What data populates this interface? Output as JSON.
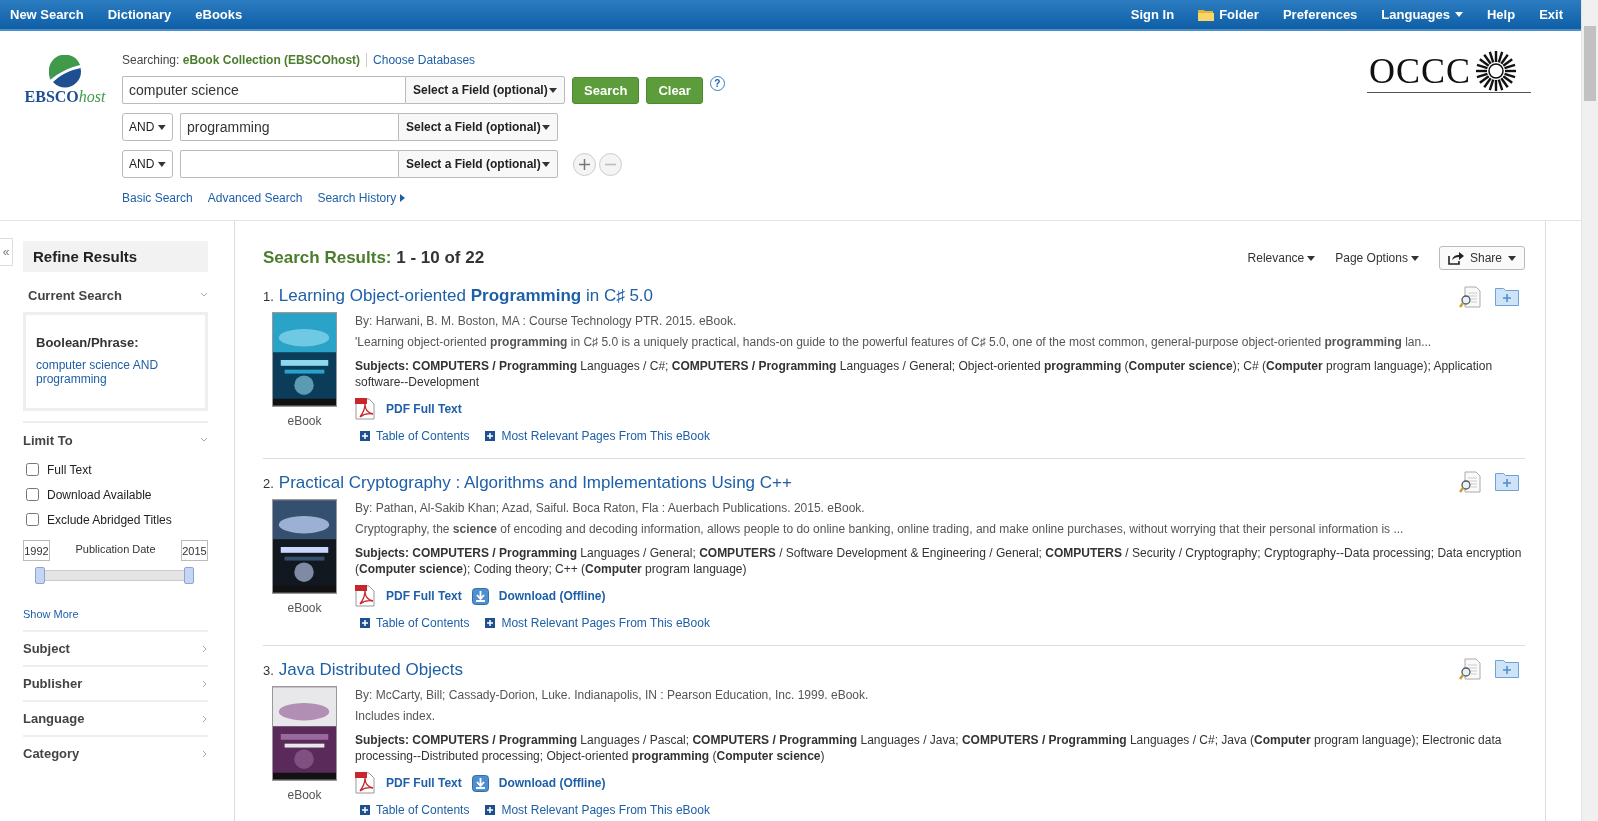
{
  "topbar": {
    "left_links": [
      "New Search",
      "Dictionary",
      "eBooks"
    ],
    "right_links": [
      {
        "label": "Sign In",
        "kind": "plain"
      },
      {
        "label": "Folder",
        "kind": "folder"
      },
      {
        "label": "Preferences",
        "kind": "plain"
      },
      {
        "label": "Languages",
        "kind": "dropdown"
      },
      {
        "label": "Help",
        "kind": "plain"
      },
      {
        "label": "Exit",
        "kind": "plain"
      }
    ]
  },
  "header": {
    "logo": {
      "main": "EBSCO",
      "suffix": "host"
    },
    "partner_logo": "OCCC"
  },
  "search": {
    "searching_label": "Searching:",
    "database": "eBook Collection (EBSCOhost)",
    "choose_link": "Choose Databases",
    "rows": [
      {
        "value": "computer science",
        "field": "Select a Field (optional)"
      },
      {
        "operator": "AND",
        "value": "programming",
        "field": "Select a Field (optional)"
      },
      {
        "operator": "AND",
        "field": "Select a Field (optional)"
      }
    ],
    "buttons": [
      "Search",
      "Clear"
    ],
    "help": "?",
    "links": [
      {
        "label": "Basic Search",
        "kind": "plain"
      },
      {
        "label": "Advanced Search",
        "kind": "plain"
      },
      {
        "label": "Search History",
        "kind": "arrow"
      }
    ]
  },
  "sidebar": {
    "collapse": "«",
    "title": "Refine Results",
    "current_search": {
      "heading": "Current Search",
      "label": "Boolean/Phrase:",
      "query": "computer science AND programming"
    },
    "limit_to": {
      "heading": "Limit To",
      "options": [
        {
          "label": "Full Text",
          "checked": false
        },
        {
          "label": "Download Available",
          "checked": false
        },
        {
          "label": "Exclude Abridged Titles",
          "checked": false
        }
      ],
      "date": {
        "from": "1992",
        "label": "Publication Date",
        "to": "2015",
        "thumbs": [
          {
            "level": 0
          },
          {
            "level": 1
          }
        ]
      },
      "show_more": "Show More"
    },
    "facets": [
      "Subject",
      "Publisher",
      "Language",
      "Category"
    ]
  },
  "results_header": {
    "label": "Search Results:",
    "range": "1 - 10 of 22",
    "sort": "Relevance",
    "page_options": "Page Options",
    "share": "Share"
  },
  "results": [
    {
      "number": "1.",
      "title": "Learning Object-oriented **Programming** in C♯ 5.0",
      "byline": "By: Harwani, B. M. Boston, MA : Course Technology PTR. 2015. eBook.",
      "abstract": "'Learning object-oriented **programming** in C♯ 5.0 is a uniquely practical, hands-on guide to the powerful features of C♯ 5.0, one of the most common, general-purpose object-oriented **programming** lan...",
      "subjects": "**Subjects: COMPUTERS / Programming** Languages / C#; **COMPUTERS / Programming** Languages / General; Object-oriented **programming** (**Computer science**); C# (**Computer** program language); Application software--Development",
      "type": "eBook",
      "links": [
        {
          "kind": "pdf",
          "label": "PDF Full Text"
        }
      ],
      "extra_links": [
        "Table of Contents",
        "Most Relevant Pages From This eBook"
      ]
    },
    {
      "number": "2.",
      "title": "Practical Cryptography : Algorithms and Implementations Using C++",
      "byline": "By: Pathan, Al-Sakib Khan; Azad, Saiful. Boca Raton, Fla : Auerbach Publications. 2015. eBook.",
      "abstract": "Cryptography, the **science** of encoding and decoding information, allows people to do online banking, online trading, and make online purchases, without worrying that their personal information is ...",
      "subjects": "**Subjects: COMPUTERS / Programming** Languages / General; **COMPUTERS** / Software Development & Engineering / General; **COMPUTERS** / Security / Cryptography; Cryptography--Data processing; Data encryption (**Computer science**); Coding theory; C++ (**Computer** program language)",
      "type": "eBook",
      "links": [
        {
          "kind": "pdf",
          "label": "PDF Full Text"
        },
        {
          "kind": "download",
          "label": "Download (Offline)"
        }
      ],
      "extra_links": [
        "Table of Contents",
        "Most Relevant Pages From This eBook"
      ]
    },
    {
      "number": "3.",
      "title": "Java Distributed Objects",
      "byline": "By: McCarty, Bill; Cassady-Dorion, Luke. Indianapolis, IN : Pearson Education, Inc. 1999. eBook.",
      "abstract": "Includes index.",
      "subjects": "**Subjects: COMPUTERS / Programming** Languages / Pascal; **COMPUTERS / Programming** Languages / Java; **COMPUTERS / Programming** Languages / C#; Java (**Computer** program language); Electronic data processing--Distributed processing; Object-oriented **programming** (**Computer science**)",
      "type": "eBook",
      "links": [
        {
          "kind": "pdf",
          "label": "PDF Full Text"
        },
        {
          "kind": "download",
          "label": "Download (Offline)"
        }
      ],
      "extra_links": [
        "Table of Contents",
        "Most Relevant Pages From This eBook"
      ]
    }
  ]
}
